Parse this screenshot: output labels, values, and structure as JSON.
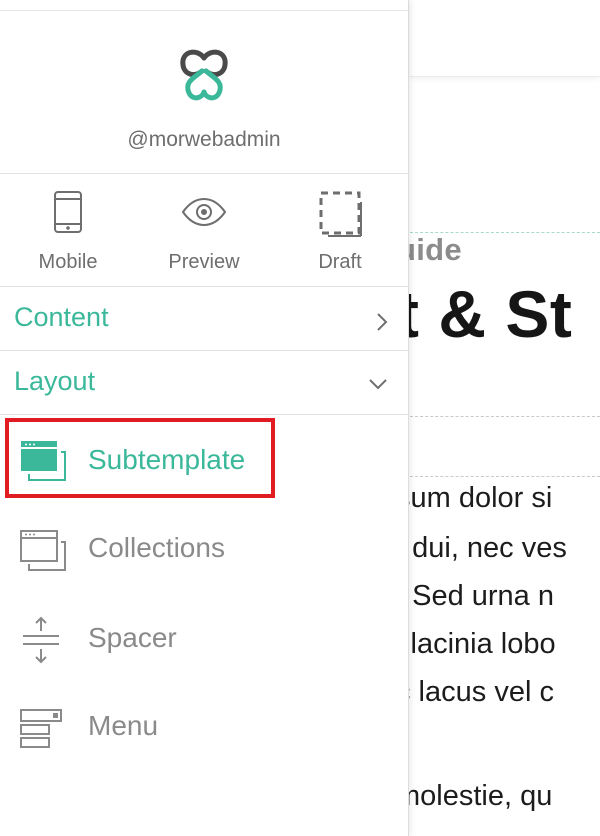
{
  "sidebar": {
    "username": "@morwebadmin",
    "tools": [
      {
        "label": "Mobile",
        "icon": "mobile-icon"
      },
      {
        "label": "Preview",
        "icon": "eye-icon"
      },
      {
        "label": "Draft",
        "icon": "draft-icon"
      }
    ],
    "sections": [
      {
        "label": "Content",
        "state": "collapsed",
        "icon": "chevron-right-icon"
      },
      {
        "label": "Layout",
        "state": "expanded",
        "icon": "chevron-down-icon"
      }
    ],
    "layout_items": [
      {
        "label": "Subtemplate",
        "icon": "subtemplate-icon",
        "active": true
      },
      {
        "label": "Collections",
        "icon": "collections-icon",
        "active": false
      },
      {
        "label": "Spacer",
        "icon": "spacer-icon",
        "active": false
      },
      {
        "label": "Menu",
        "icon": "menu-icon",
        "active": false
      }
    ]
  },
  "page": {
    "subtitle_fragment": "uide",
    "title_fragment": "t & St",
    "paragraph_lines": [
      "sum dolor si",
      "t dui, nec ves",
      ". Sed urna n",
      "i lacinia lobo",
      "c lacus vel c",
      "molestie, qu"
    ]
  },
  "colors": {
    "accent": "#3bb89a",
    "highlight": "#e01b22",
    "muted_text": "#8a8a8a"
  }
}
